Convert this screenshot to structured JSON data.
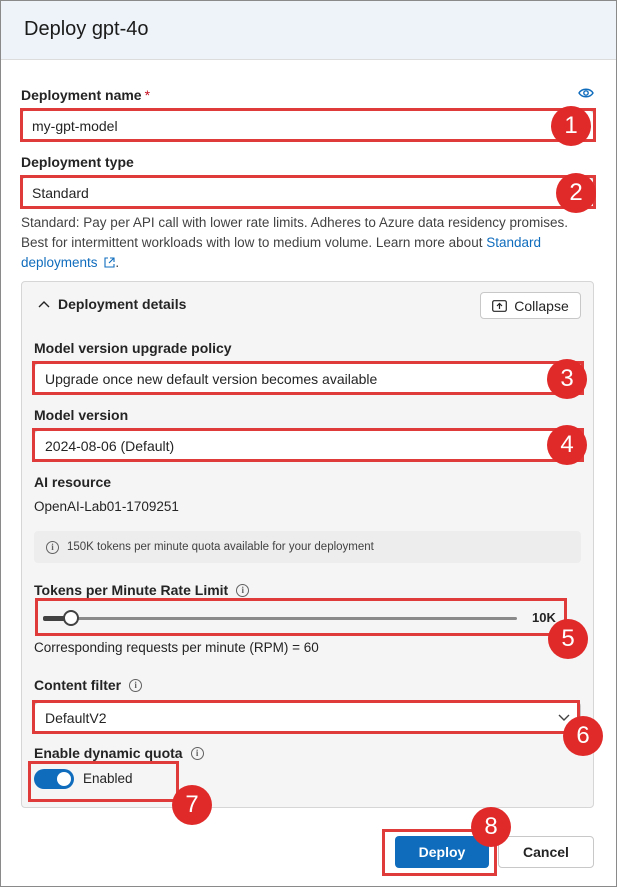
{
  "dialog": {
    "title": "Deploy gpt-4o"
  },
  "deployment_name": {
    "label": "Deployment name",
    "required_mark": "*",
    "value": "my-gpt-model",
    "icon": "eye-icon"
  },
  "deployment_type": {
    "label": "Deployment type",
    "value": "Standard",
    "help": "Standard: Pay per API call with lower rate limits. Adheres to Azure data residency promises. Best for intermittent workloads with low to medium volume. Learn more about ",
    "link": "Standard deployments"
  },
  "details": {
    "title": "Deployment details",
    "collapse_label": "Collapse",
    "upgrade_policy": {
      "label": "Model version upgrade policy",
      "value": "Upgrade once new default version becomes available"
    },
    "model_version": {
      "label": "Model version",
      "value": "2024-08-06 (Default)"
    },
    "ai_resource": {
      "label": "AI resource",
      "value": "OpenAI-Lab01-1709251"
    },
    "quota_info": "150K tokens per minute quota available for your deployment",
    "tpm": {
      "label": "Tokens per Minute Rate Limit",
      "value_label": "10K",
      "fraction": 0.06,
      "rpm_text": "Corresponding requests per minute (RPM) = 60"
    },
    "content_filter": {
      "label": "Content filter",
      "value": "DefaultV2"
    },
    "dynamic_quota": {
      "label": "Enable dynamic quota",
      "toggle_label": "Enabled",
      "enabled": true
    }
  },
  "footer": {
    "deploy_label": "Deploy",
    "cancel_label": "Cancel"
  },
  "annotations": [
    "1",
    "2",
    "3",
    "4",
    "5",
    "6",
    "7",
    "8"
  ],
  "colors": {
    "accent": "#0f6cbd",
    "annotation": "#e02a2a"
  }
}
